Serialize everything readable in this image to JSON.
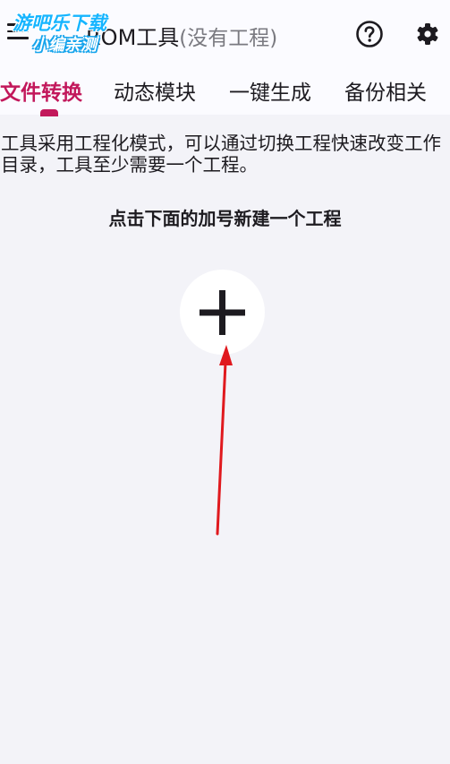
{
  "header": {
    "title": "ROM工具",
    "subtitle": "(没有工程)",
    "menu_icon": "hamburger-menu-icon",
    "help_icon": "help-circle-icon",
    "settings_icon": "gear-icon"
  },
  "watermark": {
    "line1": "游吧乐下载",
    "line2": "小编亲测"
  },
  "tabs": [
    {
      "label": "文件转换",
      "active": true
    },
    {
      "label": "动态模块",
      "active": false
    },
    {
      "label": "一键生成",
      "active": false
    },
    {
      "label": "备份相关",
      "active": false
    }
  ],
  "main": {
    "info": "工具采用工程化模式，可以通过切换工程快速改变工作目录，工具至少需要一个工程。",
    "instruction": "点击下面的加号新建一个工程",
    "add_icon": "plus-icon",
    "annotation_icon": "red-arrow-icon"
  },
  "colors": {
    "accent": "#c2185b",
    "background": "#f3f3f8",
    "bar": "#fbfbff",
    "arrow": "#e0191e",
    "watermark": "#16b5ff"
  }
}
